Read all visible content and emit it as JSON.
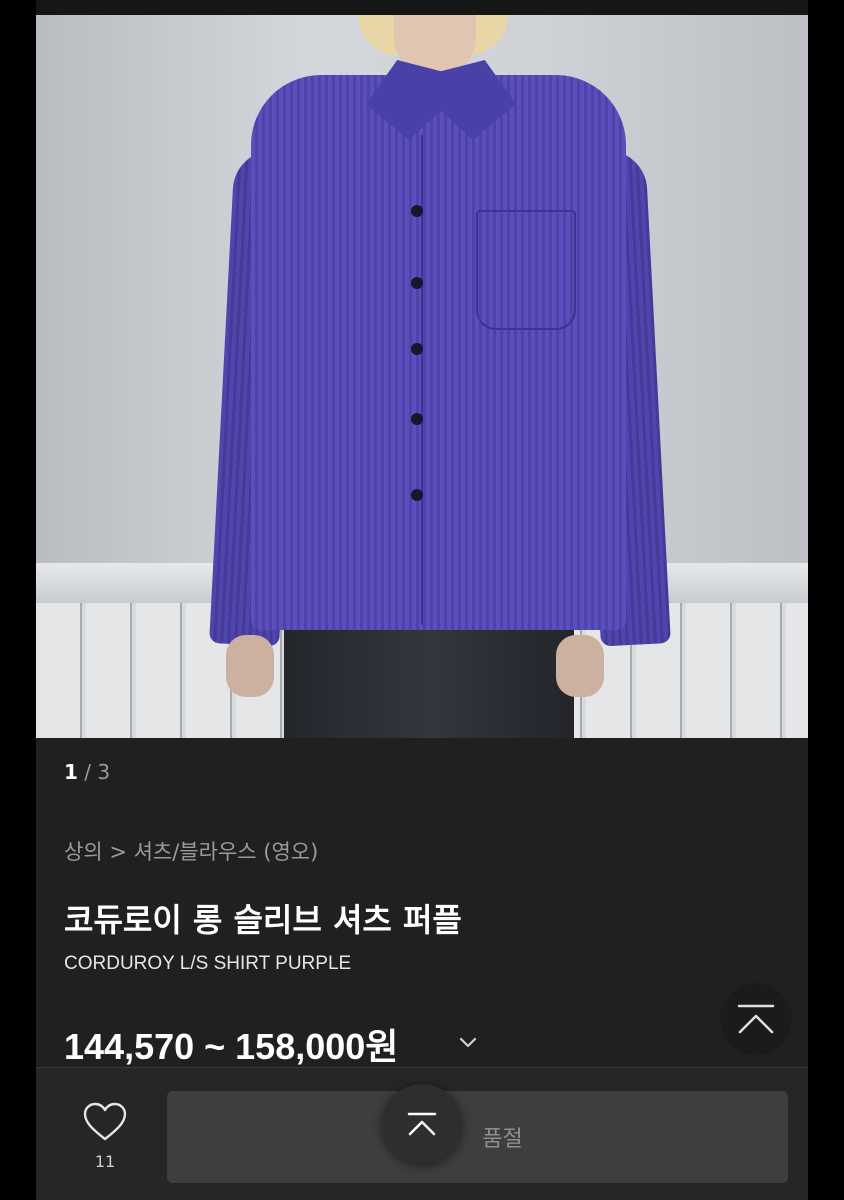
{
  "image_counter": {
    "current": "1",
    "separator": " / ",
    "total": "3"
  },
  "breadcrumb": "상의 > 셔츠/블라우스 (영오)",
  "product": {
    "title": "코듀로이 롱 슬리브 셔츠 퍼플",
    "subtitle": "CORDUROY L/S SHIRT PURPLE",
    "price": "144,570 ~ 158,000원"
  },
  "bottom_bar": {
    "like_count": "11",
    "buy_button_label": "품절"
  },
  "icons": {
    "price_toggle": "chevron-down-icon",
    "scroll_top": "arrow-up-to-top-icon",
    "like": "heart-icon"
  },
  "colors": {
    "background": "#202020",
    "text_primary": "#ffffff",
    "text_secondary": "#9a9a9a",
    "button_disabled": "#3e3e3e"
  }
}
